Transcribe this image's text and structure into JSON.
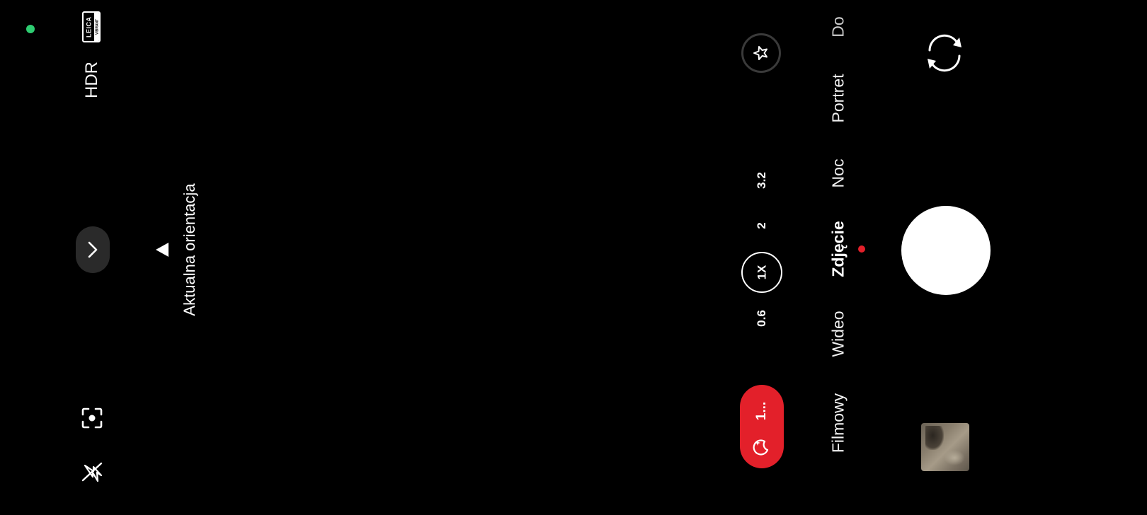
{
  "colors": {
    "background": "#000000",
    "status_dot": "#2ecc71",
    "accent_red": "#e3202a",
    "pill_bg": "#2a2a2a"
  },
  "left_panel": {
    "leica_badge": {
      "brand": "LEICA",
      "sub": "VIBRANT"
    },
    "hdr_label": "HDR",
    "expand_icon": "chevron-right-icon",
    "focus_icon": "face-focus-icon",
    "flash_icon": "flash-off-icon"
  },
  "orientation_hint": {
    "label": "Aktualna orientacja"
  },
  "zoom": {
    "levels": [
      "0.6",
      "1X",
      "2",
      "3.2"
    ],
    "active": "1X"
  },
  "night_pill": {
    "icon": "moon-sparkle-icon",
    "label": "1..."
  },
  "modes": {
    "items": [
      "Filmowy",
      "Wideo",
      "Zdjęcie",
      "Noc",
      "Portret",
      "Do"
    ],
    "active": "Zdjęcie"
  },
  "controls": {
    "ai_icon": "star-wand-icon",
    "switch_camera_icon": "switch-camera-icon",
    "shutter": "shutter-button",
    "gallery": "gallery-thumbnail"
  }
}
